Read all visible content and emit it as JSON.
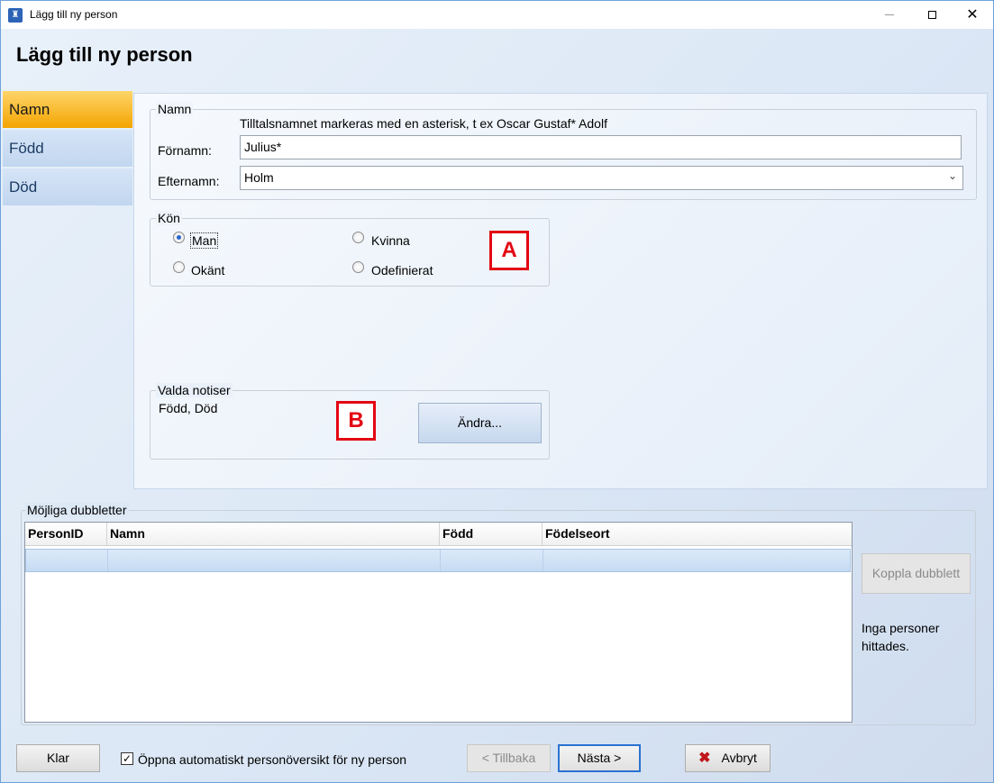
{
  "window": {
    "title": "Lägg till ny person",
    "controls": {
      "minimize": "minimize-icon",
      "maximize": "maximize-icon",
      "close": "close-icon"
    }
  },
  "page_title": "Lägg till ny person",
  "nav": {
    "items": [
      {
        "label": "Namn",
        "active": true
      },
      {
        "label": "Född",
        "active": false
      },
      {
        "label": "Död",
        "active": false
      }
    ]
  },
  "name_group": {
    "legend": "Namn",
    "hint": "Tilltalsnamnet markeras med en asterisk, t ex  Oscar Gustaf* Adolf",
    "first_name_label": "Förnamn:",
    "first_name_value": "Julius*",
    "last_name_label": "Efternamn:",
    "last_name_value": "Holm"
  },
  "gender_group": {
    "legend": "Kön",
    "options": [
      {
        "label": "Man",
        "checked": true
      },
      {
        "label": "Kvinna",
        "checked": false
      },
      {
        "label": "Okänt",
        "checked": false
      },
      {
        "label": "Odefinierat",
        "checked": false
      }
    ]
  },
  "notes_group": {
    "legend": "Valda notiser",
    "value": "Född, Död",
    "change_button": "Ändra..."
  },
  "markers": {
    "a": "A",
    "b": "B"
  },
  "duplicates": {
    "legend": "Möjliga dubbletter",
    "columns": [
      "PersonID",
      "Namn",
      "Född",
      "Födelseort"
    ],
    "link_button": "Koppla dubblett",
    "status": "Inga personer hittades."
  },
  "footer": {
    "done_button": "Klar",
    "auto_open_label": "Öppna automatiskt personöversikt för ny person",
    "auto_open_checked": true,
    "back_button": "< Tillbaka",
    "next_button": "Nästa >",
    "cancel_button": "Avbryt"
  },
  "colors": {
    "accent": "#2a72d0",
    "active_tab": "#f3a400",
    "marker": "#e30613"
  }
}
